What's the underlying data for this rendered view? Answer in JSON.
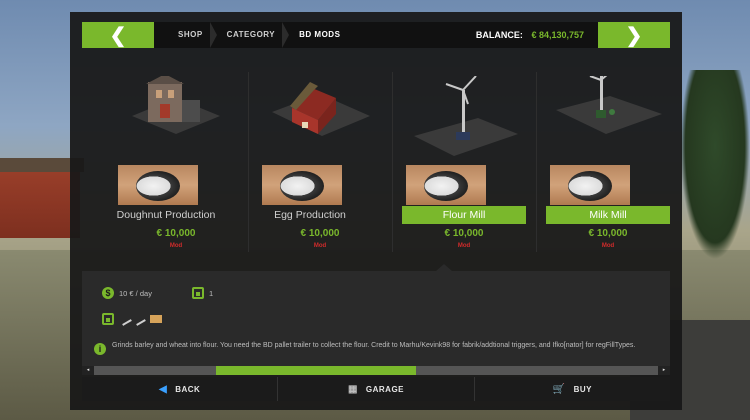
{
  "topbar": {
    "prev_icon": "chevron-left-icon",
    "next_icon": "chevron-right-icon",
    "prev_glyph": "❮",
    "next_glyph": "❯",
    "breadcrumbs": [
      "SHOP",
      "CATEGORY",
      "BD MODS"
    ],
    "balance_label": "BALANCE:",
    "balance_value": "€ 84,130,757"
  },
  "items": [
    {
      "name": "Doughnut Production",
      "price": "€ 10,000",
      "tag": "Mod",
      "selected": false
    },
    {
      "name": "Egg Production",
      "price": "€ 10,000",
      "tag": "Mod",
      "selected": false
    },
    {
      "name": "Flour Mill",
      "price": "€ 10,000",
      "tag": "Mod",
      "selected": true
    },
    {
      "name": "Milk Mill",
      "price": "€ 10,000",
      "tag": "Mod",
      "selected": true
    }
  ],
  "details": {
    "upkeep_icon": "dollar-coin-icon",
    "upkeep_glyph": "$",
    "upkeep": "10 € / day",
    "count_icon": "storage-box-icon",
    "count": "1",
    "info_glyph": "i",
    "description": "Grinds barley and wheat into flour. You need the BD pallet trailer to collect the flour. Credit to Marhu/Kevink98 for fabrik/addtional triggers, and Ifko[nator] for regFillTypes."
  },
  "scrollbar": {
    "left_glyph": "◂",
    "right_glyph": "▸"
  },
  "bottom": {
    "back_label": "BACK",
    "back_glyph": "◀",
    "garage_label": "GARAGE",
    "garage_glyph": "▦",
    "buy_label": "BUY",
    "buy_glyph": "🛒"
  },
  "colors": {
    "accent": "#7ab82c",
    "tag": "#d12b2b",
    "panel": "#181818"
  }
}
